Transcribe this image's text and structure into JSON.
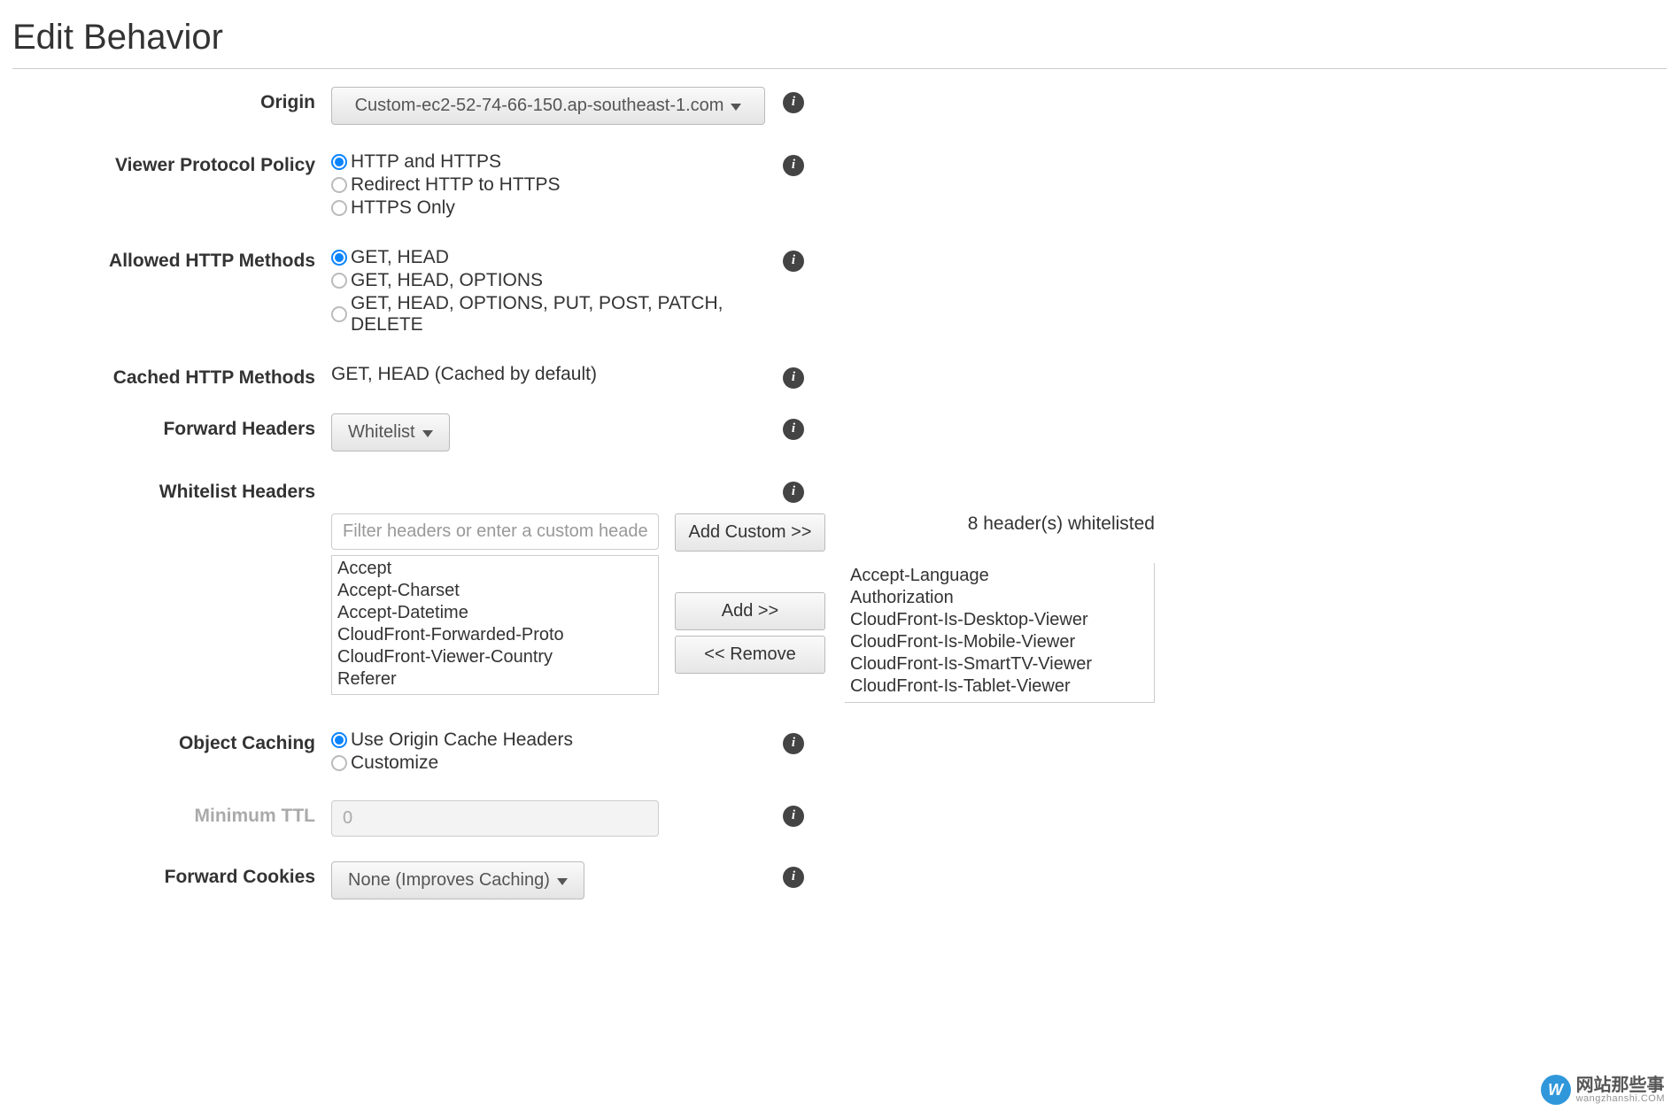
{
  "page_title": "Edit Behavior",
  "fields": {
    "origin": {
      "label": "Origin",
      "value": "Custom-ec2-52-74-66-150.ap-southeast-1.com"
    },
    "viewer_protocol": {
      "label": "Viewer Protocol Policy",
      "options": [
        "HTTP and HTTPS",
        "Redirect HTTP to HTTPS",
        "HTTPS Only"
      ],
      "selected_index": 0
    },
    "allowed_methods": {
      "label": "Allowed HTTP Methods",
      "options": [
        "GET, HEAD",
        "GET, HEAD, OPTIONS",
        "GET, HEAD, OPTIONS, PUT, POST, PATCH, DELETE"
      ],
      "selected_index": 0
    },
    "cached_methods": {
      "label": "Cached HTTP Methods",
      "value": "GET, HEAD (Cached by default)"
    },
    "forward_headers": {
      "label": "Forward Headers",
      "value": "Whitelist"
    },
    "whitelist_headers": {
      "label": "Whitelist Headers",
      "filter_placeholder": "Filter headers or enter a custom header",
      "add_custom_btn": "Add Custom >>",
      "add_btn": "Add >>",
      "remove_btn": "<< Remove",
      "count_text": "8 header(s) whitelisted",
      "available": [
        "Accept",
        "Accept-Charset",
        "Accept-Datetime",
        "CloudFront-Forwarded-Proto",
        "CloudFront-Viewer-Country",
        "Referer"
      ],
      "selected": [
        "Accept-Language",
        "Authorization",
        "CloudFront-Is-Desktop-Viewer",
        "CloudFront-Is-Mobile-Viewer",
        "CloudFront-Is-SmartTV-Viewer",
        "CloudFront-Is-Tablet-Viewer"
      ]
    },
    "object_caching": {
      "label": "Object Caching",
      "options": [
        "Use Origin Cache Headers",
        "Customize"
      ],
      "selected_index": 0
    },
    "min_ttl": {
      "label": "Minimum TTL",
      "value": "0"
    },
    "forward_cookies": {
      "label": "Forward Cookies",
      "value": "None (Improves Caching)"
    }
  },
  "watermark": {
    "badge": "W",
    "cn": "网站那些事",
    "domain": "wangzhanshi.COM"
  }
}
